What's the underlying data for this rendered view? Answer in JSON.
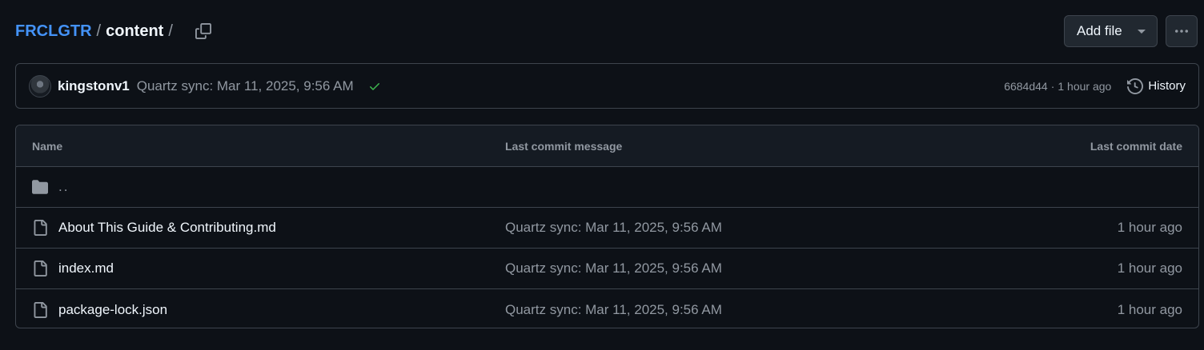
{
  "breadcrumb": {
    "repo": "FRCLGTR",
    "separator": "/",
    "current": "content",
    "trailing_separator": "/"
  },
  "header": {
    "add_file_label": "Add file",
    "more_label": "···"
  },
  "commit": {
    "author": "kingstonv1",
    "message": "Quartz sync: Mar 11, 2025, 9:56 AM",
    "sha": "6684d44",
    "dot": "·",
    "time": "1 hour ago",
    "history_label": "History",
    "status": "success"
  },
  "table": {
    "headers": {
      "name": "Name",
      "message": "Last commit message",
      "date": "Last commit date"
    },
    "parent_dir": "..",
    "rows": [
      {
        "type": "file",
        "name": "About This Guide & Contributing.md",
        "message": "Quartz sync: Mar 11, 2025, 9:56 AM",
        "date": "1 hour ago"
      },
      {
        "type": "file",
        "name": "index.md",
        "message": "Quartz sync: Mar 11, 2025, 9:56 AM",
        "date": "1 hour ago"
      },
      {
        "type": "file",
        "name": "package-lock.json",
        "message": "Quartz sync: Mar 11, 2025, 9:56 AM",
        "date": "1 hour ago"
      }
    ]
  },
  "colors": {
    "background": "#0d1117",
    "link": "#4493f8",
    "border": "#3d444d",
    "muted": "#9198a1",
    "success": "#3fb950"
  },
  "icons": [
    "copy-icon",
    "triangle-down-icon",
    "kebab-horizontal-icon",
    "check-icon",
    "history-icon",
    "folder-icon",
    "file-icon"
  ]
}
